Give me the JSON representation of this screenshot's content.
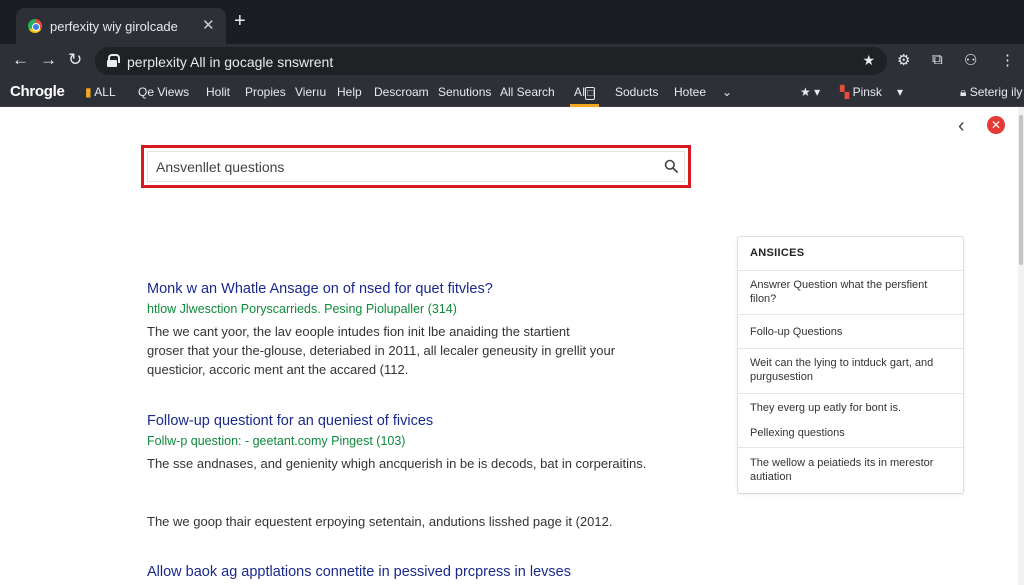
{
  "browser": {
    "tab_title": "perfexity wiy girolcade",
    "tab_close": "✕",
    "new_tab": "+",
    "url": "perplexity All in gocagle snswrent",
    "bookmarks": {
      "brand": "Chrogle",
      "items": [
        "ALL",
        "Qe Views",
        "Holit",
        "Propies",
        "Vierıu",
        "Help",
        "Descroam",
        "Senutions",
        "All Search"
      ],
      "active": "AI",
      "more": [
        "Soducts",
        "Hotee"
      ],
      "pinsk": "Pinsk",
      "setting": "Seterig ily"
    }
  },
  "search": {
    "value": "Ansvenllet questions"
  },
  "results": [
    {
      "title": "Monk w an Whatle Ansage on of nsed for quet fitvles?",
      "url": "htlow Jlwesction Poryscarrieds. Pesing Piolupaller (314)",
      "snippet": [
        "The we cant yoor, the lav eoople intudes fion init lbe anaiding the startient",
        "groser that your the-glouse, deteriabed in 2011, all lecaler geneusity in grellit your",
        "questicior, accoric ment ant the accared (112."
      ]
    },
    {
      "title": "Follow-up questiont for an queniest of fivices",
      "url": "Follw-p question: - geetant.comy Pingest (103)",
      "snippet": [
        "The sse andnases, and genienity whigh ancquerish in be is decods, bat in corperaitins."
      ]
    },
    {
      "title": "",
      "url": "",
      "snippet": [
        "The we goop thair equestent erpoying setentain, andutions lisshed page it (2012."
      ]
    },
    {
      "title": "Allow baok ag apptlations connetite in pessived prcpress in levses",
      "url": "",
      "snippet": []
    }
  ],
  "panel": {
    "heading": "ANSIICES",
    "items": [
      "Answrer Question what the persfient filon?",
      "Follo-up Questions",
      "Weit can the lying to intduck gart, and purgusestion",
      "They everg up eatly for bont is.",
      "Pellexing questions",
      "The wellow a peiatieds its in merestor autiation"
    ]
  },
  "colors": {
    "title_blue": "#1a2a8c",
    "url_green": "#0d8a3a",
    "highlight_red": "#d71920",
    "active_tab_underline": "#f5a623"
  },
  "icons": [
    "chrome-favicon",
    "back-arrow-icon",
    "forward-arrow-icon",
    "reload-icon",
    "lock-icon",
    "star-icon",
    "gear-icon",
    "extension-icon",
    "profile-icon",
    "menu-icon",
    "search-icon",
    "close-icon"
  ]
}
